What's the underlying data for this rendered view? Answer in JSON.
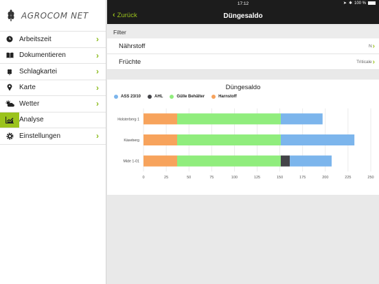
{
  "status": {
    "time": "17:12",
    "battery": "100 %"
  },
  "brand": {
    "name": "AGROCOM NET"
  },
  "sidebar": {
    "items": [
      {
        "label": "Arbeitszeit",
        "icon": "clock-icon"
      },
      {
        "label": "Dokumentieren",
        "icon": "book-icon"
      },
      {
        "label": "Schlagkartei",
        "icon": "wheat-icon"
      },
      {
        "label": "Karte",
        "icon": "map-pin-icon"
      },
      {
        "label": "Wetter",
        "icon": "weather-icon"
      },
      {
        "label": "Analyse",
        "icon": "chart-icon",
        "active": true
      },
      {
        "label": "Einstellungen",
        "icon": "gear-icon"
      }
    ]
  },
  "nav": {
    "back_label": "Zurück",
    "title": "Düngesaldo"
  },
  "filter": {
    "header": "Filter",
    "rows": [
      {
        "label": "Nährstoff",
        "value": "N"
      },
      {
        "label": "Früchte",
        "value": "Triticale"
      }
    ]
  },
  "colors": {
    "accent": "#9bc31c",
    "dark": "#1c1c1c"
  },
  "chart_data": {
    "type": "bar",
    "orientation": "horizontal",
    "stacked": true,
    "title": "Düngesaldo",
    "categories": [
      "Holsterberg 1",
      "Käseberg",
      "Mide 1-01"
    ],
    "series": [
      {
        "name": "ASS 23/10",
        "color": "#7cb5ec",
        "values": [
          0,
          0,
          0
        ]
      },
      {
        "name": "AHL",
        "color": "#434348",
        "values": [
          0,
          0,
          0
        ]
      },
      {
        "name": "Gülle Behälter",
        "color": "#90ed7d",
        "values": [
          0,
          0,
          0
        ]
      },
      {
        "name": "Harnstoff",
        "color": "#f7a35c",
        "values": [
          37,
          37,
          37
        ]
      }
    ],
    "segments": [
      [
        {
          "series": "Harnstoff",
          "value": 37
        },
        {
          "series": "Gülle Behälter",
          "value": 114
        },
        {
          "series": "ASS 23/10",
          "value": 46
        }
      ],
      [
        {
          "series": "Harnstoff",
          "value": 37
        },
        {
          "series": "Gülle Behälter",
          "value": 114
        },
        {
          "series": "ASS 23/10",
          "value": 81
        }
      ],
      [
        {
          "series": "Harnstoff",
          "value": 37
        },
        {
          "series": "Gülle Behälter",
          "value": 114
        },
        {
          "series": "AHL",
          "value": 10
        },
        {
          "series": "ASS 23/10",
          "value": 46
        }
      ]
    ],
    "xticks": [
      0,
      25,
      50,
      75,
      100,
      125,
      150,
      175,
      200,
      225,
      250
    ],
    "xlim": [
      0,
      250
    ],
    "legend_position": "top-left",
    "grid": true
  }
}
